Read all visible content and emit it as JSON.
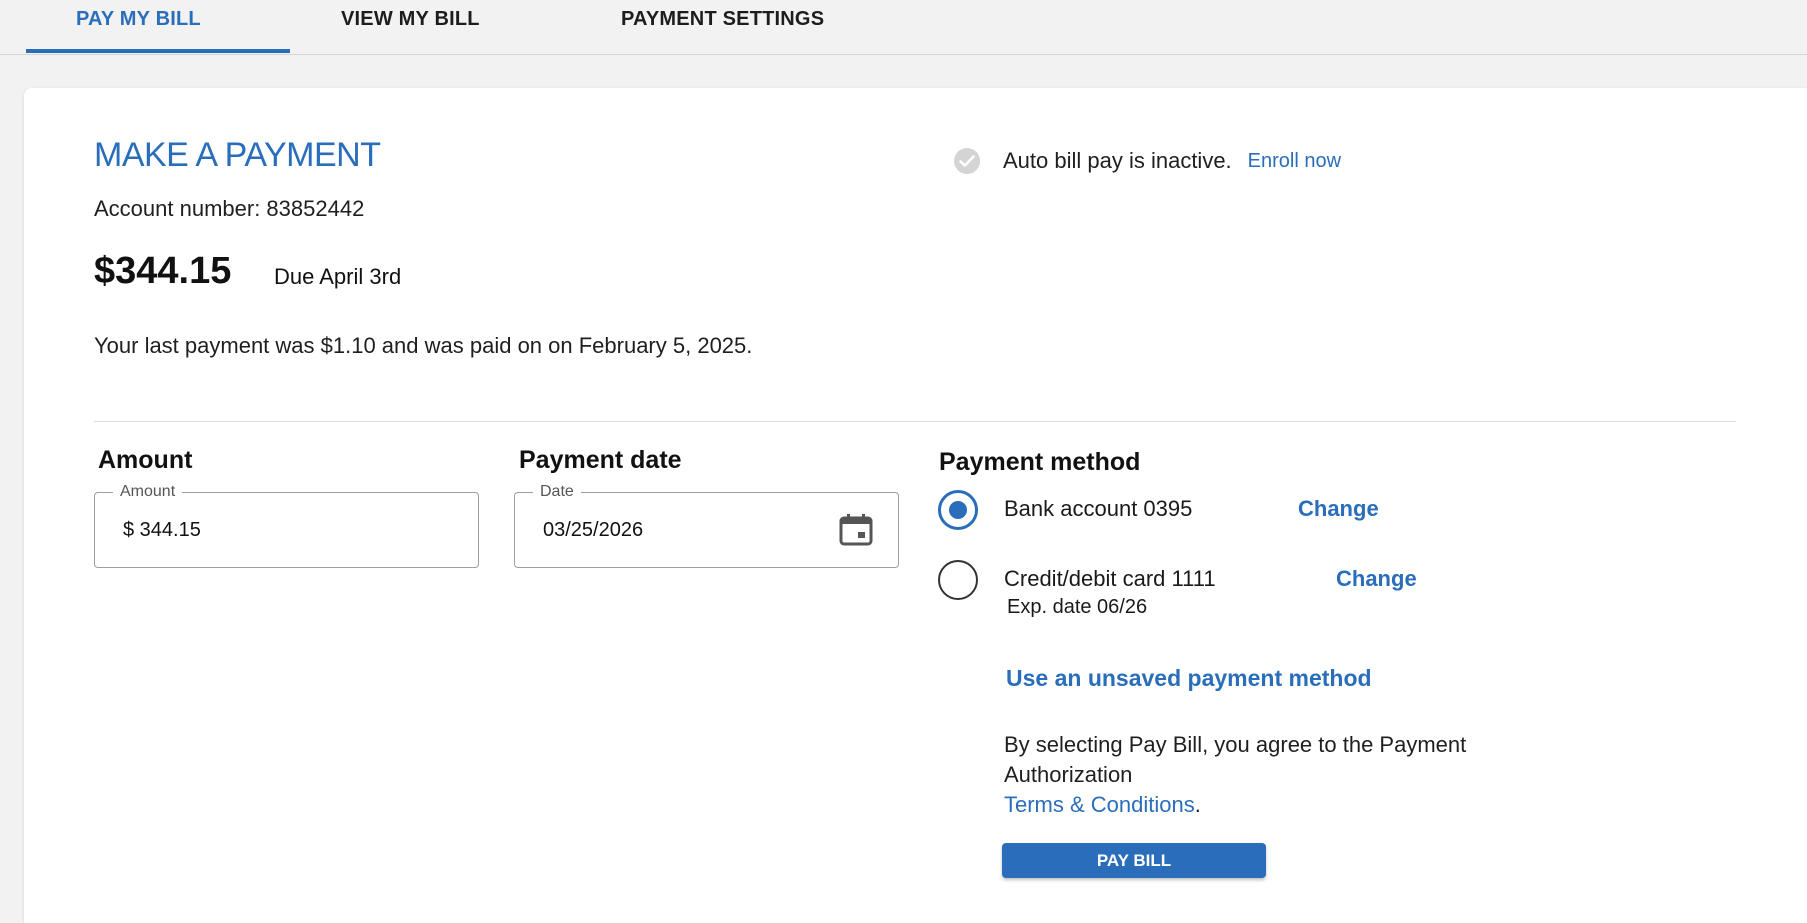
{
  "tabs": [
    {
      "label": "PAY MY BILL",
      "active": true
    },
    {
      "label": "VIEW MY BILL",
      "active": false
    },
    {
      "label": "PAYMENT SETTINGS",
      "active": false
    }
  ],
  "summary": {
    "title": "MAKE A PAYMENT",
    "account_label": "Account number: 83852442",
    "amount_due": "$344.15",
    "due_text": "Due April 3rd",
    "last_payment": "Your last payment was $1.10 and was paid on on February 5, 2025."
  },
  "autopay": {
    "status_text": "Auto bill pay is inactive.",
    "enroll_link": "Enroll now",
    "icon": "check-circle-icon"
  },
  "form": {
    "amount": {
      "heading": "Amount",
      "legend": "Amount",
      "value": "$ 344.15"
    },
    "date": {
      "heading": "Payment date",
      "legend": "Date",
      "value": "03/25/2026",
      "icon": "calendar-icon"
    }
  },
  "payment_method": {
    "heading": "Payment method",
    "options": [
      {
        "label": "Bank account 0395",
        "change_label": "Change",
        "selected": true
      },
      {
        "label": "Credit/debit card 1111",
        "change_label": "Change",
        "selected": false,
        "exp": "Exp. date 06/26"
      }
    ],
    "unsaved_link": "Use an unsaved payment method",
    "agreement_text": "By selecting Pay Bill, you agree to the Payment Authorization",
    "terms_link": "Terms & Conditions",
    "terms_suffix": ".",
    "pay_button": "PAY BILL"
  },
  "colors": {
    "accent": "#2a6ebb",
    "background": "#f2f2f2",
    "card": "#ffffff"
  }
}
